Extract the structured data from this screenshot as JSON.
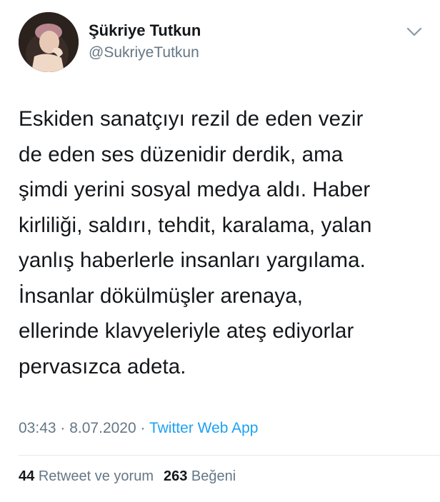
{
  "author": {
    "display_name": "Şükriye Tutkun",
    "handle": "@SukriyeTutkun",
    "avatar_icon": "user-avatar-photo"
  },
  "tweet": {
    "lines": [
      "Eskiden sanatçıyı rezil de eden vezir",
      "de eden ses düzenidir derdik, ama",
      "şimdi yerini sosyal medya aldı. Haber",
      "kirliliği, saldırı, tehdit, karalama, yalan",
      "yanlış haberlerle insanları yargılama.",
      "İnsanlar dökülmüşler arenaya,",
      "ellerinde klavyeleriyle ateş ediyorlar",
      "pervasızca adeta."
    ]
  },
  "meta": {
    "time": "03:43",
    "sep1": " · ",
    "date": "8.07.2020",
    "sep2": " · ",
    "source": "Twitter Web App"
  },
  "stats": {
    "retweets_count": "44",
    "retweets_label": "Retweet ve yorum",
    "likes_count": "263",
    "likes_label": "Beğeni"
  },
  "colors": {
    "text": "#14171a",
    "secondary": "#657786",
    "link": "#1da1f2",
    "divider": "#e1e8ed"
  },
  "icons": {
    "menu": "chevron-down-icon"
  }
}
